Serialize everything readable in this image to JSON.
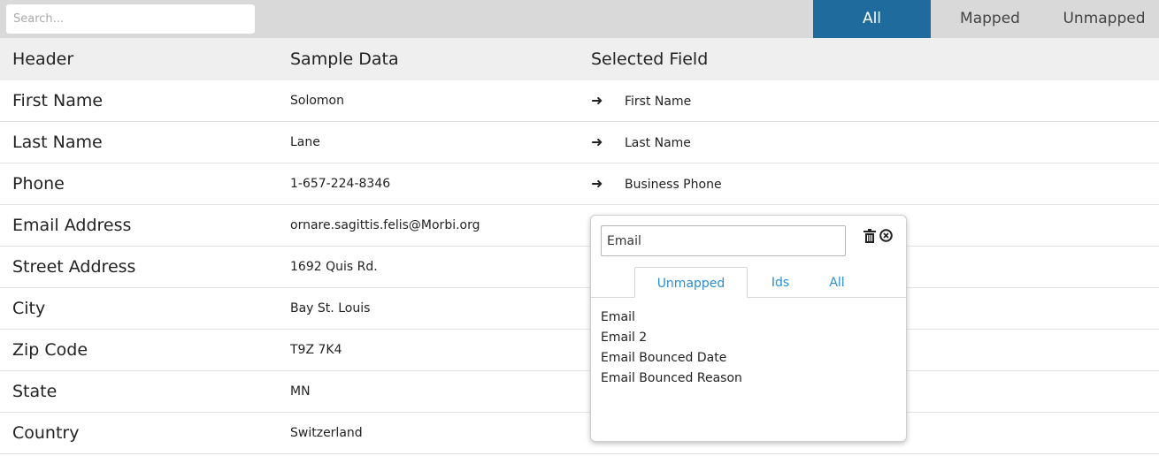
{
  "search": {
    "placeholder": "Search..."
  },
  "filters": [
    "All",
    "Mapped",
    "Unmapped"
  ],
  "columns": {
    "header": "Header",
    "sample": "Sample Data",
    "field": "Selected Field"
  },
  "rows": [
    {
      "header": "First Name",
      "sample": "Solomon",
      "field": "First Name"
    },
    {
      "header": "Last Name",
      "sample": "Lane",
      "field": "Last Name"
    },
    {
      "header": "Phone",
      "sample": "1-657-224-8346",
      "field": "Business Phone"
    },
    {
      "header": "Email Address",
      "sample": "ornare.sagittis.felis@Morbi.org",
      "field": ""
    },
    {
      "header": "Street Address",
      "sample": "1692 Quis Rd.",
      "field": ""
    },
    {
      "header": "City",
      "sample": "Bay St. Louis",
      "field": ""
    },
    {
      "header": "Zip Code",
      "sample": "T9Z 7K4",
      "field": ""
    },
    {
      "header": "State",
      "sample": "MN",
      "field": ""
    },
    {
      "header": "Country",
      "sample": "Switzerland",
      "field": ""
    }
  ],
  "arrow_glyph": "➜",
  "popup": {
    "input_value": "Email",
    "icons": [
      "trash-icon",
      "close-circle-icon"
    ],
    "tabs": [
      "Unmapped",
      "Ids",
      "All"
    ],
    "options": [
      "Email",
      "Email 2",
      "Email Bounced Date",
      "Email Bounced Reason"
    ]
  },
  "colors": {
    "active_filter": "#1f6b9e",
    "link": "#2a8fd0"
  }
}
